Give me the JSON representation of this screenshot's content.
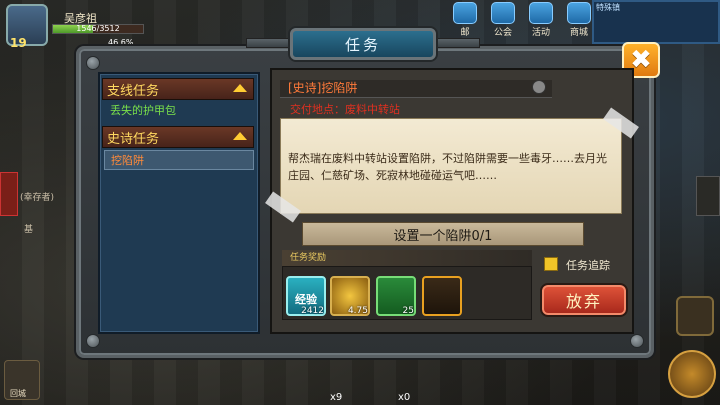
{
  "hud": {
    "player_name": "吴彦祖",
    "level": "19",
    "hp_text": "1546/3512",
    "hp_fraction": 0.44,
    "exp_text": "46.6%",
    "top_icons": [
      {
        "icon": "mail-icon",
        "label": "邮"
      },
      {
        "icon": "guild-icon",
        "label": "公会"
      },
      {
        "icon": "event-icon",
        "label": "活动"
      },
      {
        "icon": "shop-icon",
        "label": "商城"
      }
    ],
    "minimap_label": "特殊镇",
    "side_text_1": "(幸存者)",
    "side_text_2": "基",
    "back_city": "回城",
    "skill_counts": [
      "x9",
      "x0"
    ]
  },
  "dialog": {
    "title": "任务",
    "close_label": "✖",
    "categories": [
      {
        "name": "支线任务",
        "items": [
          "丢失的护甲包"
        ]
      },
      {
        "name": "史诗任务",
        "items": [
          "挖陷阱"
        ]
      }
    ],
    "selected_item": "挖陷阱",
    "task": {
      "title": "[史诗]挖陷阱",
      "location": "交付地点：废料中转站",
      "description": "帮杰瑞在废料中转站设置陷阱，不过陷阱需要一些毒牙……去月光庄园、仁慈矿场、死寂林地碰碰运气吧……",
      "objective": "设置一个陷阱0/1",
      "reward_label": "任务奖励",
      "rewards": [
        {
          "icon": "exp-icon",
          "label": "经验",
          "count": "2412"
        },
        {
          "icon": "gold-coins-icon",
          "label": "",
          "count": "4.75"
        },
        {
          "icon": "wrench-icon",
          "label": "",
          "count": "25"
        },
        {
          "icon": "scroll-icon",
          "label": "",
          "count": ""
        }
      ],
      "track_label": "任务追踪",
      "abandon_label": "放弃"
    }
  },
  "colors": {
    "accent_orange": "#ff7a3a",
    "location_red": "#e03020",
    "category_yellow": "#ffd860",
    "list_green": "#7ae04a"
  }
}
